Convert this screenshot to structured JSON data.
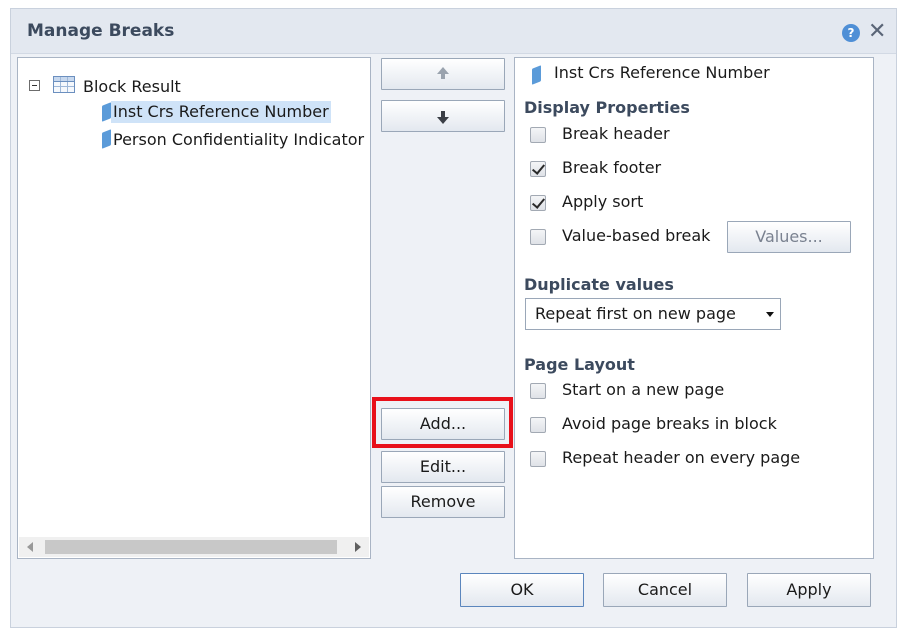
{
  "dialog": {
    "title": "Manage Breaks",
    "help_icon": "help-icon",
    "close_icon": "close-icon"
  },
  "tree": {
    "root_label": "Block Result",
    "items": [
      {
        "label": "Inst Crs Reference Number",
        "selected": true
      },
      {
        "label": "Person Confidentiality Indicator",
        "selected": false
      }
    ]
  },
  "middle_buttons": {
    "move_up_icon": "arrow-up-icon",
    "move_down_icon": "arrow-down-icon",
    "add_label": "Add...",
    "edit_label": "Edit...",
    "remove_label": "Remove"
  },
  "properties": {
    "break_name": "Inst Crs Reference Number",
    "display_title": "Display Properties",
    "break_header": {
      "label": "Break header",
      "checked": false
    },
    "break_footer": {
      "label": "Break footer",
      "checked": true
    },
    "apply_sort": {
      "label": "Apply sort",
      "checked": true
    },
    "value_based_break": {
      "label": "Value-based break",
      "checked": false
    },
    "values_label": "Values...",
    "duplicate_title": "Duplicate values",
    "duplicate_selected": "Repeat first on new page",
    "layout_title": "Page Layout",
    "start_new_page": {
      "label": "Start on a new page",
      "checked": false
    },
    "avoid_page_breaks": {
      "label": "Avoid page breaks in block",
      "checked": false
    },
    "repeat_header": {
      "label": "Repeat header on every page",
      "checked": false
    }
  },
  "footer": {
    "ok_label": "OK",
    "cancel_label": "Cancel",
    "apply_label": "Apply"
  },
  "colors": {
    "highlight": "#e8101a",
    "title_text": "#3c4a5e",
    "selection": "#cfe3f8"
  }
}
